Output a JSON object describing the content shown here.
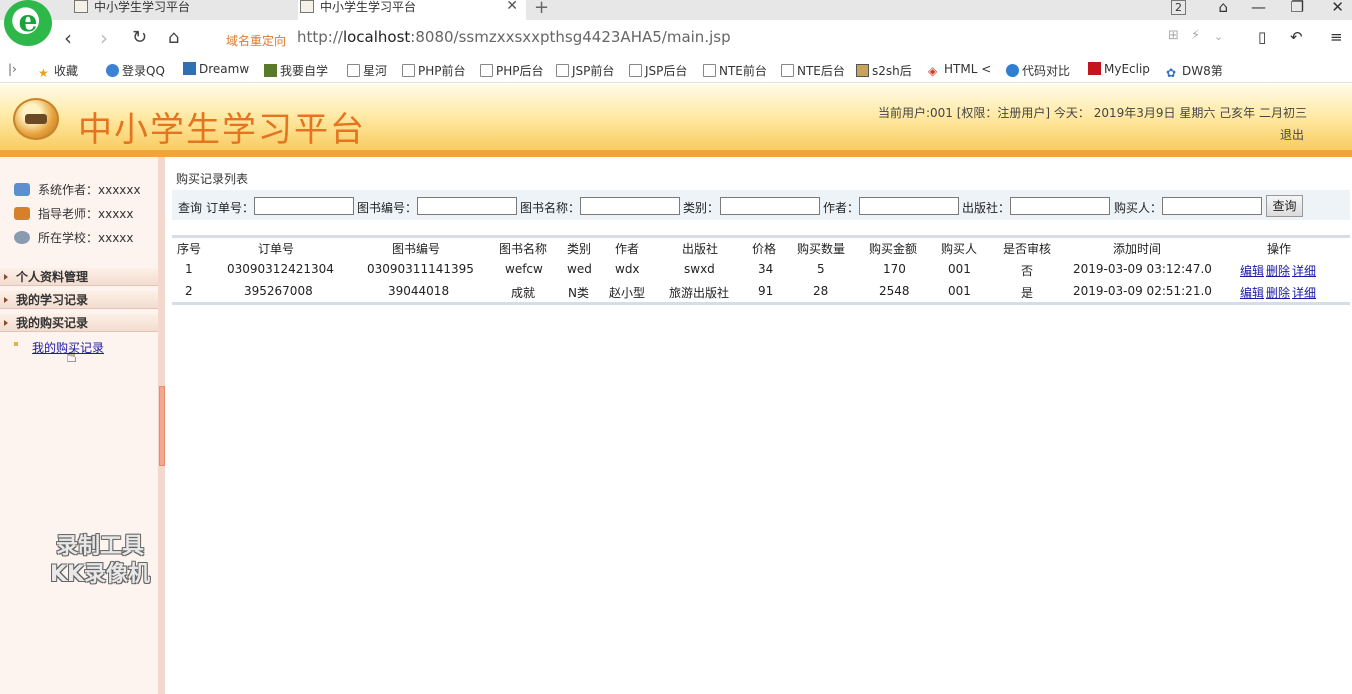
{
  "browser": {
    "tabs": [
      {
        "title": "中小学生学习平台"
      },
      {
        "title": "中小学生学习平台"
      }
    ],
    "tab_counter": "2",
    "redirect_label": "域名重定向",
    "url_prefix": "http://",
    "url_host": "localhost",
    "url_rest": ":8080/ssmzxxsxxpthsg4423AHA5/main.jsp",
    "bookmarks": [
      "收藏",
      "登录QQ",
      "Dreamw",
      "我要自学",
      "星河",
      "PHP前台",
      "PHP后台",
      "JSP前台",
      "JSP后台",
      "NTE前台",
      "NTE后台",
      "s2sh后",
      "HTML <",
      "代码对比",
      "MyEclip",
      "DW8第"
    ]
  },
  "header": {
    "site_title": "中小学生学习平台",
    "user_info": "当前用户:001 [权限：注册用户] 今天： 2019年3月9日 星期六 己亥年 二月初三",
    "logout": "退出"
  },
  "sidebar": {
    "info": [
      {
        "label": "系统作者：xxxxxx",
        "icon": "users-icon"
      },
      {
        "label": "指导老师：xxxxx",
        "icon": "teacher-icon"
      },
      {
        "label": "所在学校：xxxxx",
        "icon": "school-icon"
      }
    ],
    "menus": [
      "个人资料管理",
      "我的学习记录",
      "我的购买记录"
    ],
    "active_item": "我的购买记录",
    "watermark_line1": "录制工具",
    "watermark_line2": "KK录像机"
  },
  "main": {
    "title": "购买记录列表",
    "search": {
      "prefix": "查询",
      "fields": [
        "订单号：",
        "图书编号：",
        "图书名称：",
        "类别：",
        "作者：",
        "出版社：",
        "购买人："
      ],
      "button": "查询"
    },
    "table": {
      "columns": [
        "序号",
        "订单号",
        "图书编号",
        "图书名称",
        "类别",
        "作者",
        "出版社",
        "价格",
        "购买数量",
        "购买金额",
        "购买人",
        "是否审核",
        "添加时间",
        "操作"
      ],
      "rows": [
        [
          "1",
          "03090312421304",
          "03090311141395",
          "wefcw",
          "wed",
          "wdx",
          "swxd",
          "34",
          "5",
          "170",
          "001",
          "否",
          "2019-03-09 03:12:47.0"
        ],
        [
          "2",
          "395267008",
          "39044018",
          "成就",
          "N类",
          "赵小型",
          "旅游出版社",
          "91",
          "28",
          "2548",
          "001",
          "是",
          "2019-03-09 02:51:21.0"
        ]
      ],
      "actions": [
        "编辑",
        "删除",
        "详细"
      ]
    }
  }
}
